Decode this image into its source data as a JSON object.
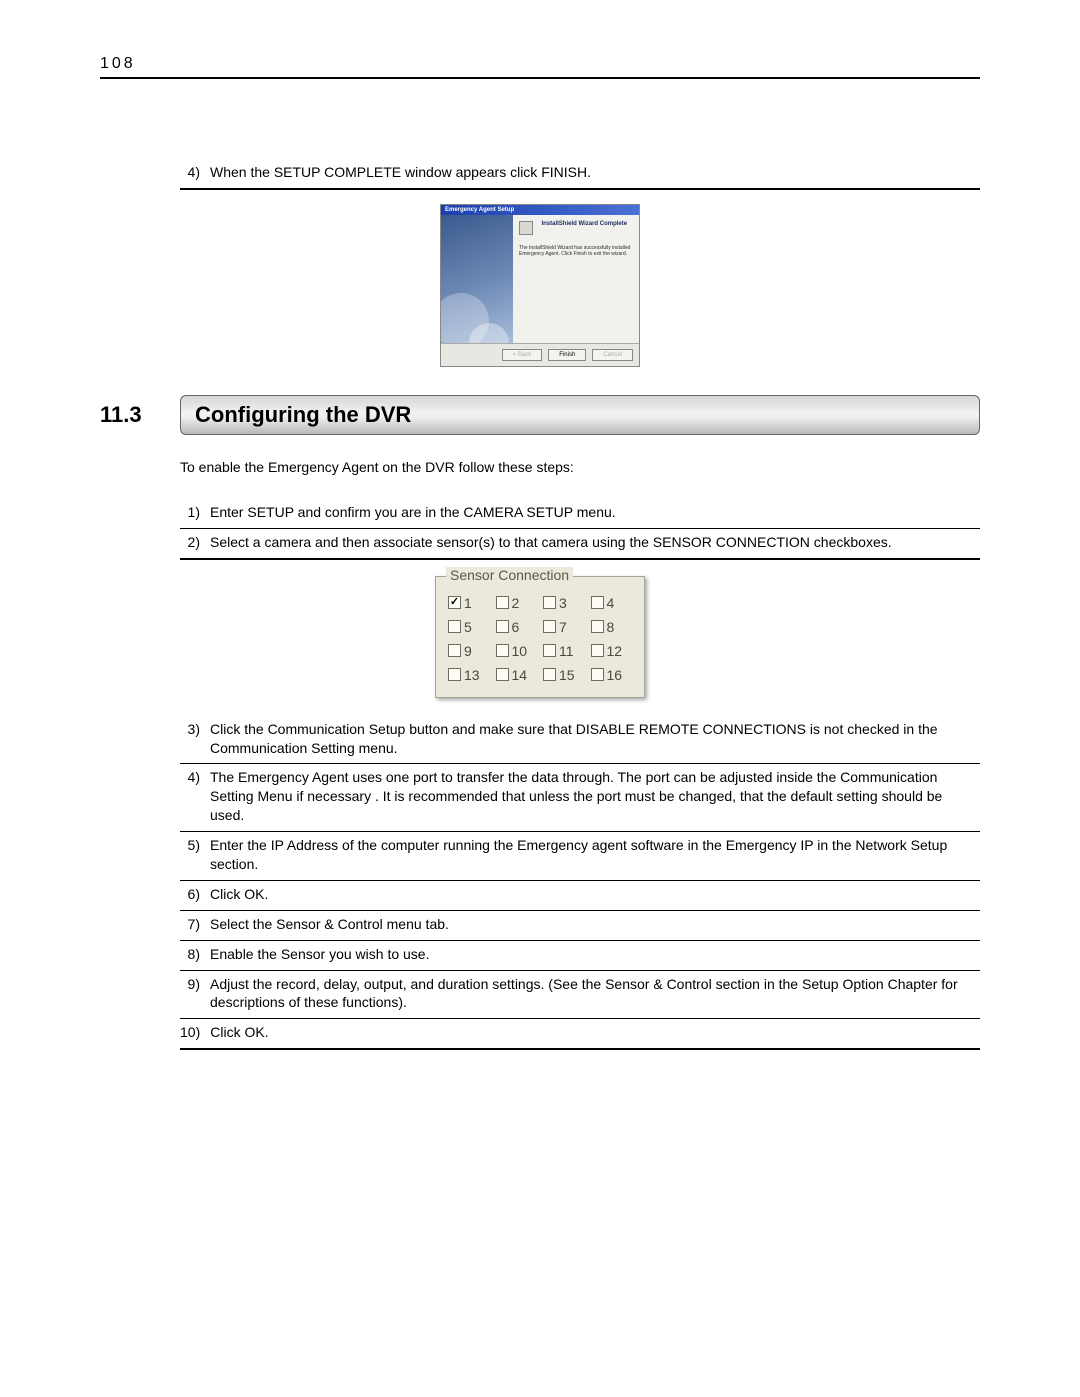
{
  "page_number": "108",
  "top_step": {
    "num": "4)",
    "text": "When the SETUP COMPLETE window appears click FINISH."
  },
  "wizard": {
    "title": "Emergency Agent Setup",
    "heading": "InstallShield Wizard Complete",
    "body": "The InstallShield Wizard has successfully installed Emergency Agent. Click Finish to exit the wizard.",
    "buttons": {
      "back": "< Back",
      "finish": "Finish",
      "cancel": "Cancel"
    }
  },
  "section": {
    "num": "11.3",
    "title": "Configuring the DVR"
  },
  "intro": "To enable the Emergency Agent on the DVR follow these steps:",
  "steps_a": [
    {
      "num": "1)",
      "text": "Enter SETUP and confirm you are in the CAMERA SETUP menu."
    },
    {
      "num": "2)",
      "text": "Select a camera and then associate sensor(s) to that camera using the SENSOR CONNECTION checkboxes."
    }
  ],
  "sensor": {
    "legend": "Sensor Connection",
    "items": [
      {
        "label": "1",
        "checked": true
      },
      {
        "label": "2",
        "checked": false
      },
      {
        "label": "3",
        "checked": false
      },
      {
        "label": "4",
        "checked": false
      },
      {
        "label": "5",
        "checked": false
      },
      {
        "label": "6",
        "checked": false
      },
      {
        "label": "7",
        "checked": false
      },
      {
        "label": "8",
        "checked": false
      },
      {
        "label": "9",
        "checked": false
      },
      {
        "label": "10",
        "checked": false
      },
      {
        "label": "11",
        "checked": false
      },
      {
        "label": "12",
        "checked": false
      },
      {
        "label": "13",
        "checked": false
      },
      {
        "label": "14",
        "checked": false
      },
      {
        "label": "15",
        "checked": false
      },
      {
        "label": "16",
        "checked": false
      }
    ]
  },
  "steps_b": [
    {
      "num": "3)",
      "text": "Click the Communication Setup button and make sure that DISABLE REMOTE CONNECTIONS is not checked in the Communication Setting menu."
    },
    {
      "num": "4)",
      "text": "The Emergency Agent uses one port to transfer the data through. The port can be adjusted inside the Communication Setting Menu  if necessary . It is recommended that unless the port must be changed, that the default setting should be used."
    },
    {
      "num": "5)",
      "text": "Enter the IP Address of the computer running the Emergency agent software in the Emergency IP in the Network Setup section."
    },
    {
      "num": "6)",
      "text": "Click OK."
    },
    {
      "num": "7)",
      "text": "Select the Sensor & Control menu tab."
    },
    {
      "num": "8)",
      "text": "Enable the Sensor you wish to use."
    },
    {
      "num": "9)",
      "text": "Adjust the record, delay, output, and duration settings. (See the Sensor & Control section in the Setup Option Chapter for descriptions of these functions)."
    },
    {
      "num": "10)",
      "text": "Click OK."
    }
  ]
}
